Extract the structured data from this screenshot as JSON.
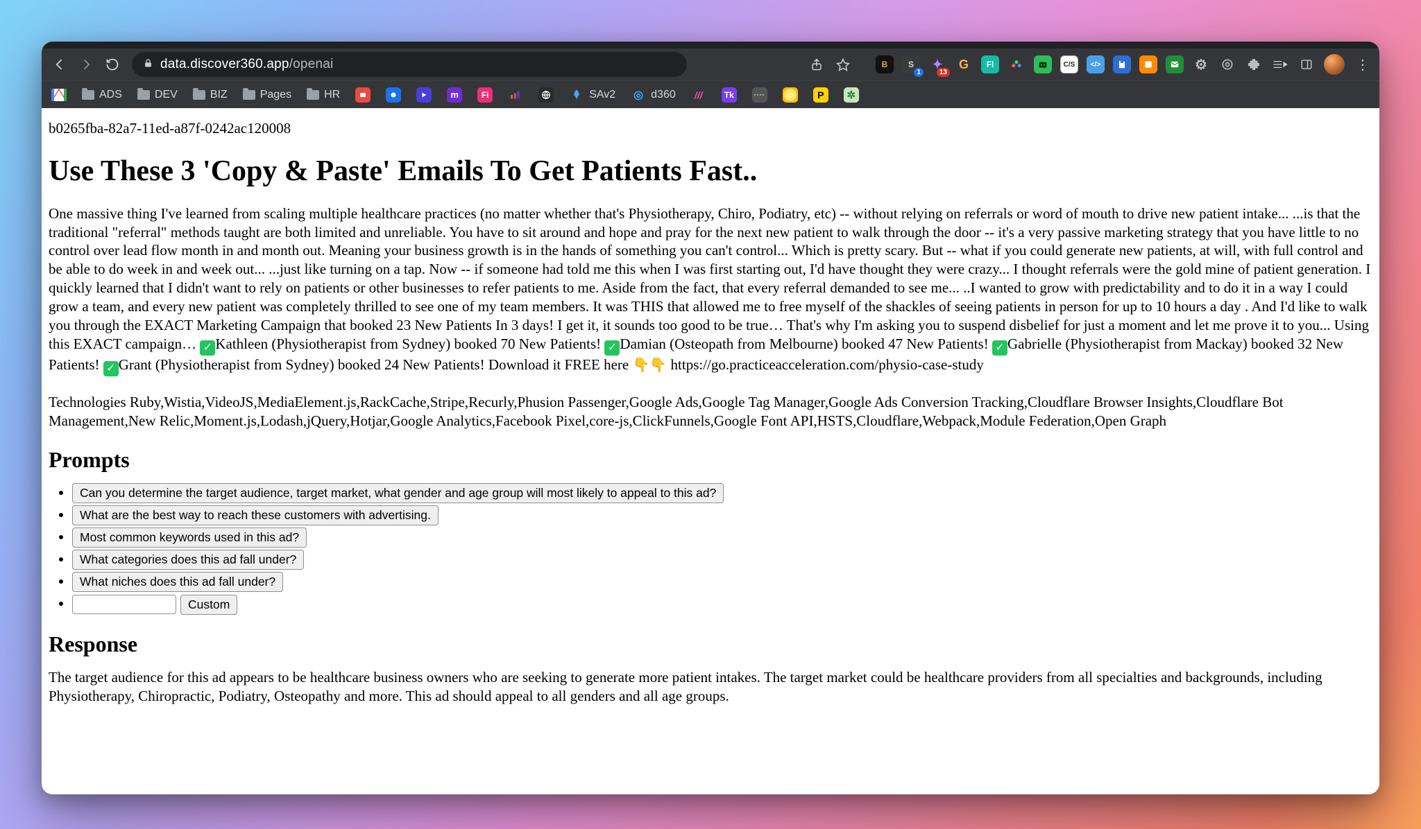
{
  "browser": {
    "url_host": "data.discover360.app",
    "url_path": "/openai",
    "ext_badge_s": "1",
    "ext_badge_purple": "13"
  },
  "bookmarks": {
    "folders": [
      "ADS",
      "DEV",
      "BIZ",
      "Pages",
      "HR"
    ],
    "sav2": "SAv2",
    "d360": "d360"
  },
  "page": {
    "uuid": "b0265fba-82a7-11ed-a87f-0242ac120008",
    "title": "Use These 3 'Copy & Paste' Emails To Get Patients Fast..",
    "body_pre": "One massive thing I've learned from scaling multiple healthcare practices (no matter whether that's Physiotherapy, Chiro, Podiatry, etc) -- without relying on referrals or word of mouth to drive new patient intake... ...is that the traditional \"referral\" methods taught are both limited and unreliable. You have to sit around and hope and pray for the next new patient to walk through the door -- it's a very passive marketing strategy that you have little to no control over lead flow month in and month out. Meaning your business growth is in the hands of something you can't control... Which is pretty scary. But -- what if you could generate new patients, at will, with full control and be able to do week in and week out... ...just like turning on a tap. Now -- if someone had told me this when I was first starting out, I'd have thought they were crazy... I thought referrals were the gold mine of patient generation. I quickly learned that I didn't want to rely on patients or other businesses to refer patients to me. Aside from the fact, that every referral demanded to see me... ..I wanted to grow with predictability and to do it in a way I could grow a team, and every new patient was completely thrilled to see one of my team members. It was THIS that allowed me to free myself of the shackles of seeing patients in person for up to 10 hours a day . And I'd like to walk you through the EXACT Marketing Campaign that booked 23 New Patients In 3 days! I get it, it sounds too good to be true… That's why I'm asking you to suspend disbelief for just a moment and let me prove it to you... Using this EXACT campaign… ",
    "bullets": [
      "Kathleen (Physiotherapist from Sydney) booked 70 New Patients! ",
      "Damian (Osteopath from Melbourne) booked 47 New Patients! ",
      "Gabrielle (Physiotherapist from Mackay) booked 32 New Patients! ",
      "Grant (Physiotherapist from Sydney) booked 24 New Patients! Download it FREE here "
    ],
    "body_link": "https://go.practiceacceleration.com/physio-case-study",
    "technologies_label": "Technologies ",
    "technologies": "Ruby,Wistia,VideoJS,MediaElement.js,RackCache,Stripe,Recurly,Phusion Passenger,Google Ads,Google Tag Manager,Google Ads Conversion Tracking,Cloudflare Browser Insights,Cloudflare Bot Management,New Relic,Moment.js,Lodash,jQuery,Hotjar,Google Analytics,Facebook Pixel,core-js,ClickFunnels,Google Font API,HSTS,Cloudflare,Webpack,Module Federation,Open Graph",
    "prompts_heading": "Prompts",
    "prompts": [
      "Can you determine the target audience, target market, what gender and age group will most likely to appeal to this ad?",
      "What are the best way to reach these customers with advertising.",
      "Most common keywords used in this ad?",
      "What categories does this ad fall under?",
      "What niches does this ad fall under?"
    ],
    "custom_label": "Custom",
    "response_heading": "Response",
    "response": "The target audience for this ad appears to be healthcare business owners who are seeking to generate more patient intakes. The target market could be healthcare providers from all specialties and backgrounds, including Physiotherapy, Chiropractic, Podiatry, Osteopathy and more. This ad should appeal to all genders and all age groups."
  }
}
